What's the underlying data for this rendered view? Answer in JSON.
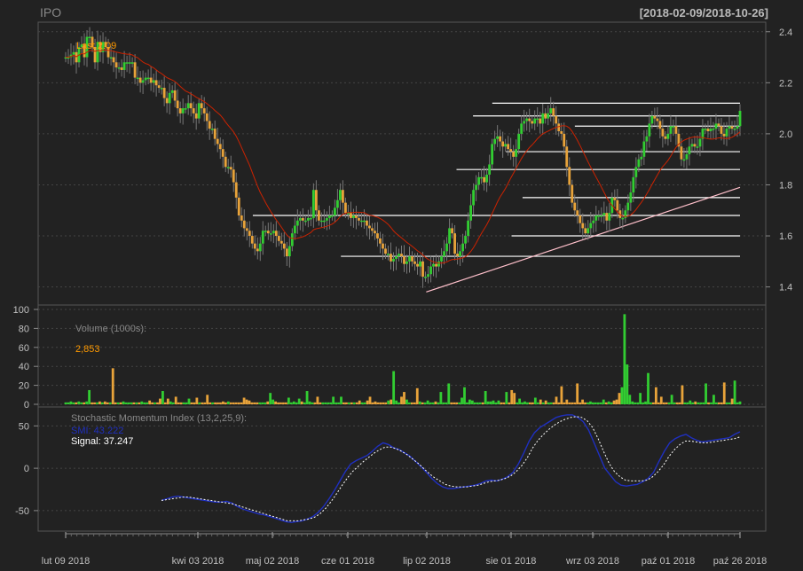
{
  "header": {
    "symbol": "IPO",
    "range": "[2018-02-09/2018-10-26]"
  },
  "colors": {
    "background": "#222222",
    "up": "#32cd32",
    "down": "#e8a33a",
    "ma": "#cc2200",
    "hline": "#ffffff",
    "trend": "#ffc0cb",
    "smi": "#1f2fbf",
    "signal": "#ffffff",
    "axis_text": "#c0c0c0",
    "grid": "#444444"
  },
  "chart_data": [
    {
      "type": "candlestick",
      "panel": "price",
      "last_label": "Last 2.09",
      "ylim": [
        1.35,
        2.42
      ],
      "y_ticks": [
        "1.4",
        "1.6",
        "1.8",
        "2.0",
        "2.2",
        "2.4"
      ],
      "close": [
        2.3,
        2.3,
        2.31,
        2.32,
        2.28,
        2.34,
        2.35,
        2.3,
        2.38,
        2.38,
        2.34,
        2.28,
        2.36,
        2.32,
        2.36,
        2.34,
        2.3,
        2.3,
        2.28,
        2.26,
        2.26,
        2.25,
        2.28,
        2.28,
        2.28,
        2.28,
        2.22,
        2.22,
        2.2,
        2.21,
        2.22,
        2.22,
        2.2,
        2.21,
        2.19,
        2.18,
        2.18,
        2.14,
        2.12,
        2.16,
        2.17,
        2.13,
        2.1,
        2.08,
        2.1,
        2.1,
        2.12,
        2.1,
        2.08,
        2.06,
        2.12,
        2.1,
        2.08,
        2.05,
        2.02,
        2.02,
        1.98,
        1.96,
        1.94,
        1.91,
        1.87,
        1.87,
        1.86,
        1.81,
        1.75,
        1.68,
        1.66,
        1.63,
        1.62,
        1.6,
        1.57,
        1.55,
        1.54,
        1.57,
        1.62,
        1.62,
        1.61,
        1.61,
        1.62,
        1.6,
        1.58,
        1.57,
        1.55,
        1.52,
        1.56,
        1.61,
        1.64,
        1.66,
        1.67,
        1.66,
        1.66,
        1.67,
        1.67,
        1.78,
        1.7,
        1.66,
        1.66,
        1.66,
        1.67,
        1.68,
        1.68,
        1.71,
        1.74,
        1.78,
        1.73,
        1.69,
        1.69,
        1.67,
        1.68,
        1.67,
        1.66,
        1.66,
        1.66,
        1.64,
        1.63,
        1.62,
        1.61,
        1.59,
        1.57,
        1.55,
        1.53,
        1.53,
        1.5,
        1.51,
        1.52,
        1.53,
        1.52,
        1.49,
        1.5,
        1.52,
        1.5,
        1.49,
        1.48,
        1.5,
        1.44,
        1.44,
        1.45,
        1.48,
        1.49,
        1.48,
        1.5,
        1.52,
        1.54,
        1.57,
        1.63,
        1.61,
        1.53,
        1.52,
        1.54,
        1.57,
        1.6,
        1.66,
        1.72,
        1.78,
        1.8,
        1.83,
        1.83,
        1.81,
        1.84,
        1.88,
        1.96,
        1.98,
        1.99,
        1.97,
        1.95,
        1.96,
        1.94,
        1.93,
        1.91,
        1.94,
        2.0,
        2.04,
        2.05,
        2.06,
        2.05,
        2.04,
        2.06,
        2.06,
        2.04,
        2.08,
        2.06,
        2.08,
        2.1,
        2.07,
        2.04,
        2.01,
        2.0,
        1.95,
        1.87,
        1.8,
        1.73,
        1.7,
        1.68,
        1.65,
        1.63,
        1.61,
        1.63,
        1.65,
        1.66,
        1.68,
        1.68,
        1.68,
        1.69,
        1.66,
        1.69,
        1.75,
        1.74,
        1.7,
        1.67,
        1.67,
        1.7,
        1.73,
        1.77,
        1.83,
        1.87,
        1.9,
        1.91,
        1.97,
        1.99,
        2.04,
        2.07,
        2.06,
        2.05,
        2.02,
        1.99,
        1.98,
        2.0,
        2.03,
        2.03,
        2.0,
        1.95,
        1.9,
        1.9,
        1.92,
        1.95,
        1.96,
        1.95,
        1.95,
        1.98,
        2.02,
        2.02,
        2.01,
        2.02,
        2.02,
        2.04,
        2.03,
        2.0,
        1.99,
        2.02,
        2.03,
        2.02,
        2.02,
        2.03,
        2.09
      ],
      "open_close_hint": "up=green, down=orange; wicks drawn from close ±spread",
      "ma_label": "",
      "hlines": [
        {
          "y": 2.12,
          "x0": 155,
          "x1": 245
        },
        {
          "y": 2.07,
          "x0": 148,
          "x1": 245
        },
        {
          "y": 2.03,
          "x0": 185,
          "x1": 245
        },
        {
          "y": 1.93,
          "x0": 160,
          "x1": 245
        },
        {
          "y": 1.86,
          "x0": 142,
          "x1": 245
        },
        {
          "y": 1.75,
          "x0": 166,
          "x1": 245
        },
        {
          "y": 1.68,
          "x0": 68,
          "x1": 245
        },
        {
          "y": 1.6,
          "x0": 162,
          "x1": 245
        },
        {
          "y": 1.52,
          "x0": 100,
          "x1": 245
        }
      ],
      "trendline": {
        "x0": 131,
        "y0": 1.38,
        "x1": 245,
        "y1": 1.79
      }
    },
    {
      "type": "bar",
      "panel": "volume",
      "title": "Volume (1000s):",
      "last_value": "2,853",
      "ylim": [
        0,
        100
      ],
      "y_ticks": [
        "0",
        "20",
        "40",
        "60",
        "80",
        "100"
      ],
      "values": [
        2,
        2,
        3,
        2,
        2,
        3,
        2,
        2,
        3,
        15,
        2,
        2,
        2,
        3,
        2,
        3,
        2,
        2,
        38,
        2,
        2,
        2,
        3,
        2,
        2,
        2,
        2,
        2,
        2,
        3,
        2,
        2,
        4,
        2,
        2,
        2,
        6,
        14,
        2,
        6,
        3,
        2,
        8,
        2,
        2,
        2,
        2,
        6,
        2,
        2,
        7,
        2,
        2,
        2,
        10,
        2,
        2,
        2,
        2,
        2,
        3,
        2,
        3,
        2,
        2,
        2,
        2,
        2,
        7,
        5,
        4,
        2,
        2,
        2,
        2,
        2,
        2,
        3,
        12,
        5,
        3,
        2,
        2,
        2,
        2,
        7,
        2,
        3,
        2,
        6,
        3,
        2,
        14,
        3,
        2,
        2,
        8,
        2,
        2,
        2,
        2,
        2,
        8,
        2,
        2,
        8,
        2,
        2,
        2,
        2,
        2,
        2,
        4,
        2,
        2,
        4,
        8,
        2,
        3,
        2,
        2,
        2,
        2,
        4,
        5,
        35,
        4,
        2,
        8,
        13,
        5,
        2,
        2,
        2,
        17,
        3,
        2,
        2,
        4,
        2,
        2,
        3,
        2,
        13,
        2,
        2,
        22,
        2,
        2,
        2,
        2,
        7,
        18,
        2,
        5,
        4,
        2,
        2,
        2,
        2,
        14,
        3,
        3,
        4,
        2,
        4,
        2,
        2,
        13,
        2,
        15,
        12,
        2,
        6,
        2,
        3,
        2,
        2,
        2,
        7,
        2,
        5,
        2,
        4,
        2,
        2,
        2,
        8,
        2,
        19,
        2,
        5,
        2,
        2,
        2,
        22,
        2,
        5,
        2,
        2,
        3,
        2,
        2,
        2,
        2,
        5,
        2,
        3,
        2,
        4,
        5,
        12,
        18,
        95,
        42,
        10,
        3,
        2,
        2,
        12,
        2,
        3,
        33,
        2,
        2,
        18,
        2,
        8,
        2,
        2,
        2,
        10,
        2,
        2,
        2,
        20,
        2,
        2,
        4,
        2,
        3,
        2,
        2,
        2,
        22,
        2,
        2,
        10,
        2,
        2,
        2,
        23,
        2,
        2,
        6,
        25,
        2,
        3
      ],
      "colors_up_down_from_price": true
    },
    {
      "type": "line",
      "panel": "smi",
      "title": "Stochastic Momentum Index (13,2,25,9):",
      "series": [
        {
          "name": "SMI: 43.222",
          "values": [
            -38,
            -36,
            -34,
            -33,
            -34,
            -35,
            -36,
            -37,
            -38,
            -39,
            -40,
            -40,
            -39,
            -41,
            -45,
            -48,
            -50,
            -52,
            -54,
            -55,
            -57,
            -59,
            -61,
            -63,
            -64,
            -63,
            -62,
            -60,
            -57,
            -52,
            -45,
            -36,
            -26,
            -15,
            -4,
            5,
            9,
            12,
            15,
            20,
            26,
            30,
            28,
            24,
            22,
            18,
            14,
            8,
            2,
            -5,
            -12,
            -18,
            -22,
            -24,
            -24,
            -23,
            -22,
            -21,
            -20,
            -18,
            -15,
            -14,
            -15,
            -13,
            -10,
            -5,
            5,
            18,
            32,
            42,
            48,
            52,
            56,
            60,
            62,
            63,
            63,
            60,
            55,
            45,
            30,
            15,
            0,
            -8,
            -16,
            -20,
            -21,
            -20,
            -19,
            -16,
            -12,
            -5,
            8,
            20,
            30,
            35,
            38,
            40,
            36,
            33,
            31,
            32,
            33,
            34,
            35,
            36,
            40,
            43
          ]
        },
        {
          "name": "Signal: 37.247",
          "values": [
            -38,
            -37,
            -36,
            -35,
            -34,
            -34,
            -35,
            -36,
            -37,
            -38,
            -39,
            -40,
            -41,
            -42,
            -44,
            -46,
            -48,
            -50,
            -52,
            -54,
            -56,
            -58,
            -60,
            -62,
            -62,
            -62,
            -61,
            -60,
            -58,
            -54,
            -48,
            -40,
            -31,
            -21,
            -12,
            -4,
            2,
            8,
            13,
            18,
            22,
            25,
            25,
            23,
            20,
            16,
            11,
            6,
            0,
            -6,
            -11,
            -15,
            -19,
            -21,
            -22,
            -22,
            -22,
            -21,
            -20,
            -18,
            -16,
            -15,
            -14,
            -12,
            -9,
            -4,
            3,
            12,
            24,
            33,
            40,
            46,
            51,
            55,
            58,
            60,
            61,
            60,
            56,
            48,
            35,
            20,
            6,
            -4,
            -10,
            -14,
            -15,
            -15,
            -15,
            -14,
            -10,
            -4,
            4,
            14,
            22,
            28,
            32,
            32,
            31,
            30,
            30,
            31,
            32,
            33,
            34,
            35,
            37
          ]
        }
      ],
      "ylim": [
        -70,
        65
      ],
      "y_ticks": [
        "-50",
        "0",
        "50"
      ]
    }
  ],
  "x_axis": {
    "labels": [
      "lut 09 2018",
      "kwi 03 2018",
      "maj 02 2018",
      "cze 01 2018",
      "lip 02 2018",
      "sie 01 2018",
      "wrz 03 2018",
      "paź 01 2018",
      "paź 26 2018"
    ]
  }
}
